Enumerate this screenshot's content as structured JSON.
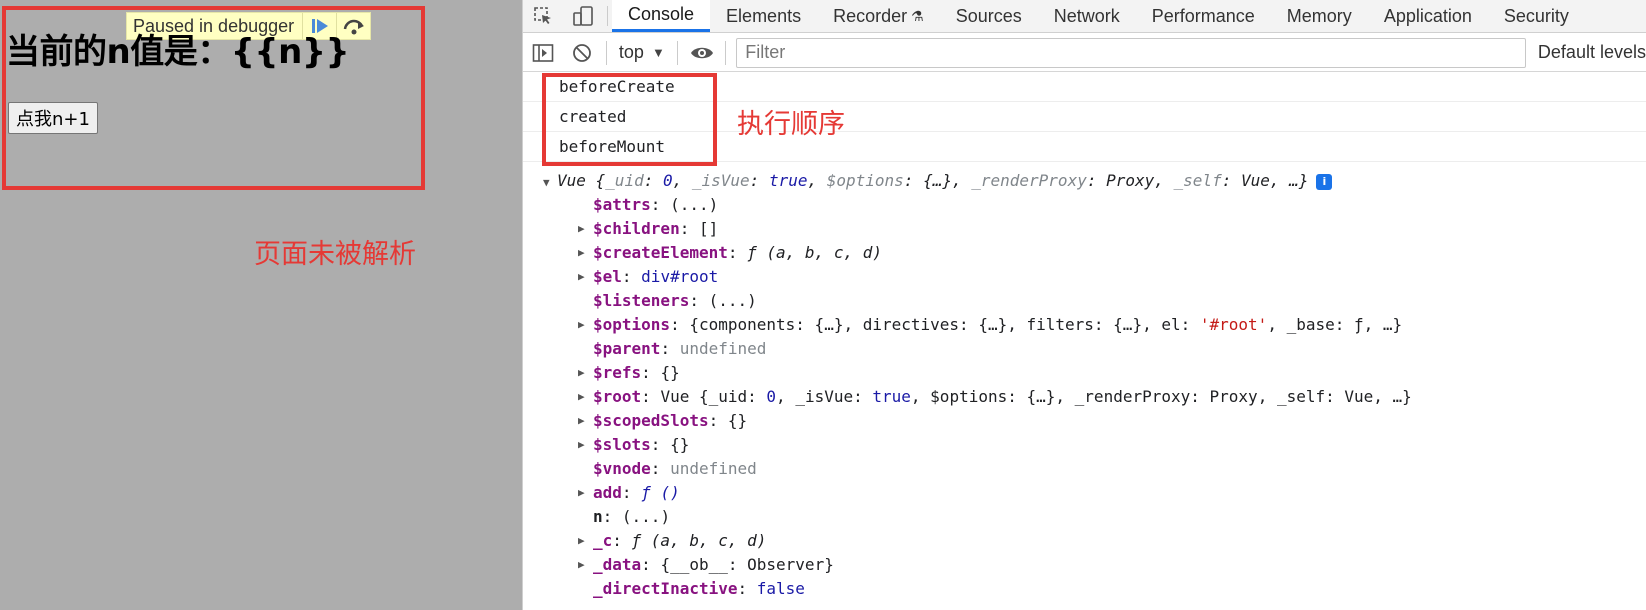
{
  "page": {
    "paused_label": "Paused in debugger",
    "heading": "当前的n值是：{{n}}",
    "increment_button": "点我n+1",
    "annotation": "页面未被解析"
  },
  "devtools": {
    "tabs": [
      "Console",
      "Elements",
      "Recorder",
      "Sources",
      "Network",
      "Performance",
      "Memory",
      "Application",
      "Security"
    ],
    "active_tab": "Console",
    "toolbar": {
      "context": "top",
      "filter_placeholder": "Filter",
      "levels_label": "Default levels"
    },
    "console": {
      "log_lines": [
        "beforeCreate",
        "created",
        "beforeMount"
      ],
      "annotation": "执行顺序",
      "object_summary": {
        "prefix": "Vue {",
        "uid_key": "_uid",
        "uid_val": "0",
        "isvue_key": "_isVue",
        "isvue_val": "true",
        "options_key": "$options",
        "options_val": "{…}",
        "renderproxy_key": "_renderProxy",
        "renderproxy_val": "Proxy",
        "self_key": "_self",
        "self_val": "Vue",
        "suffix": "…}"
      },
      "properties": [
        {
          "key": "$attrs",
          "value": "(...)"
        },
        {
          "key": "$children",
          "value": "[]"
        },
        {
          "key": "$createElement",
          "value": "ƒ (a, b, c, d)"
        },
        {
          "key": "$el",
          "value": "div#root"
        },
        {
          "key": "$listeners",
          "value": "(...)"
        },
        {
          "key": "$options",
          "value_a": "{components: {…}, directives: {…}, filters: {…}, el: ",
          "value_str": "'#root'",
          "value_b": ", _base: ƒ, …}"
        },
        {
          "key": "$parent",
          "value": "undefined"
        },
        {
          "key": "$refs",
          "value": "{}"
        },
        {
          "key": "$root",
          "value_a": "Vue {_uid: ",
          "value_num": "0",
          "value_b": ", _isVue: ",
          "value_kw": "true",
          "value_c": ", $options: {…}, _renderProxy: Proxy, _self: Vue, …}"
        },
        {
          "key": "$scopedSlots",
          "value": "{}"
        },
        {
          "key": "$slots",
          "value": "{}"
        },
        {
          "key": "$vnode",
          "value": "undefined"
        },
        {
          "key": "add",
          "value": "ƒ ()"
        },
        {
          "key": "n",
          "value": "(...)"
        },
        {
          "key": "_c",
          "value": "ƒ (a, b, c, d)"
        },
        {
          "key": "_data",
          "value": "{__ob__: Observer}"
        },
        {
          "key": "_directInactive",
          "value": "false"
        }
      ]
    }
  },
  "colors": {
    "annotation_red": "#e53935",
    "page_gray": "#adadad",
    "paused_yellow": "#ffffc2",
    "accent_blue": "#1a73e8",
    "prop_key_purple": "#881280"
  },
  "icons": [
    "resume-icon",
    "step-over-icon",
    "inspect-icon",
    "device-toggle-icon",
    "flask-icon",
    "sidebar-toggle-icon",
    "clear-console-icon",
    "eye-icon",
    "info-icon"
  ]
}
